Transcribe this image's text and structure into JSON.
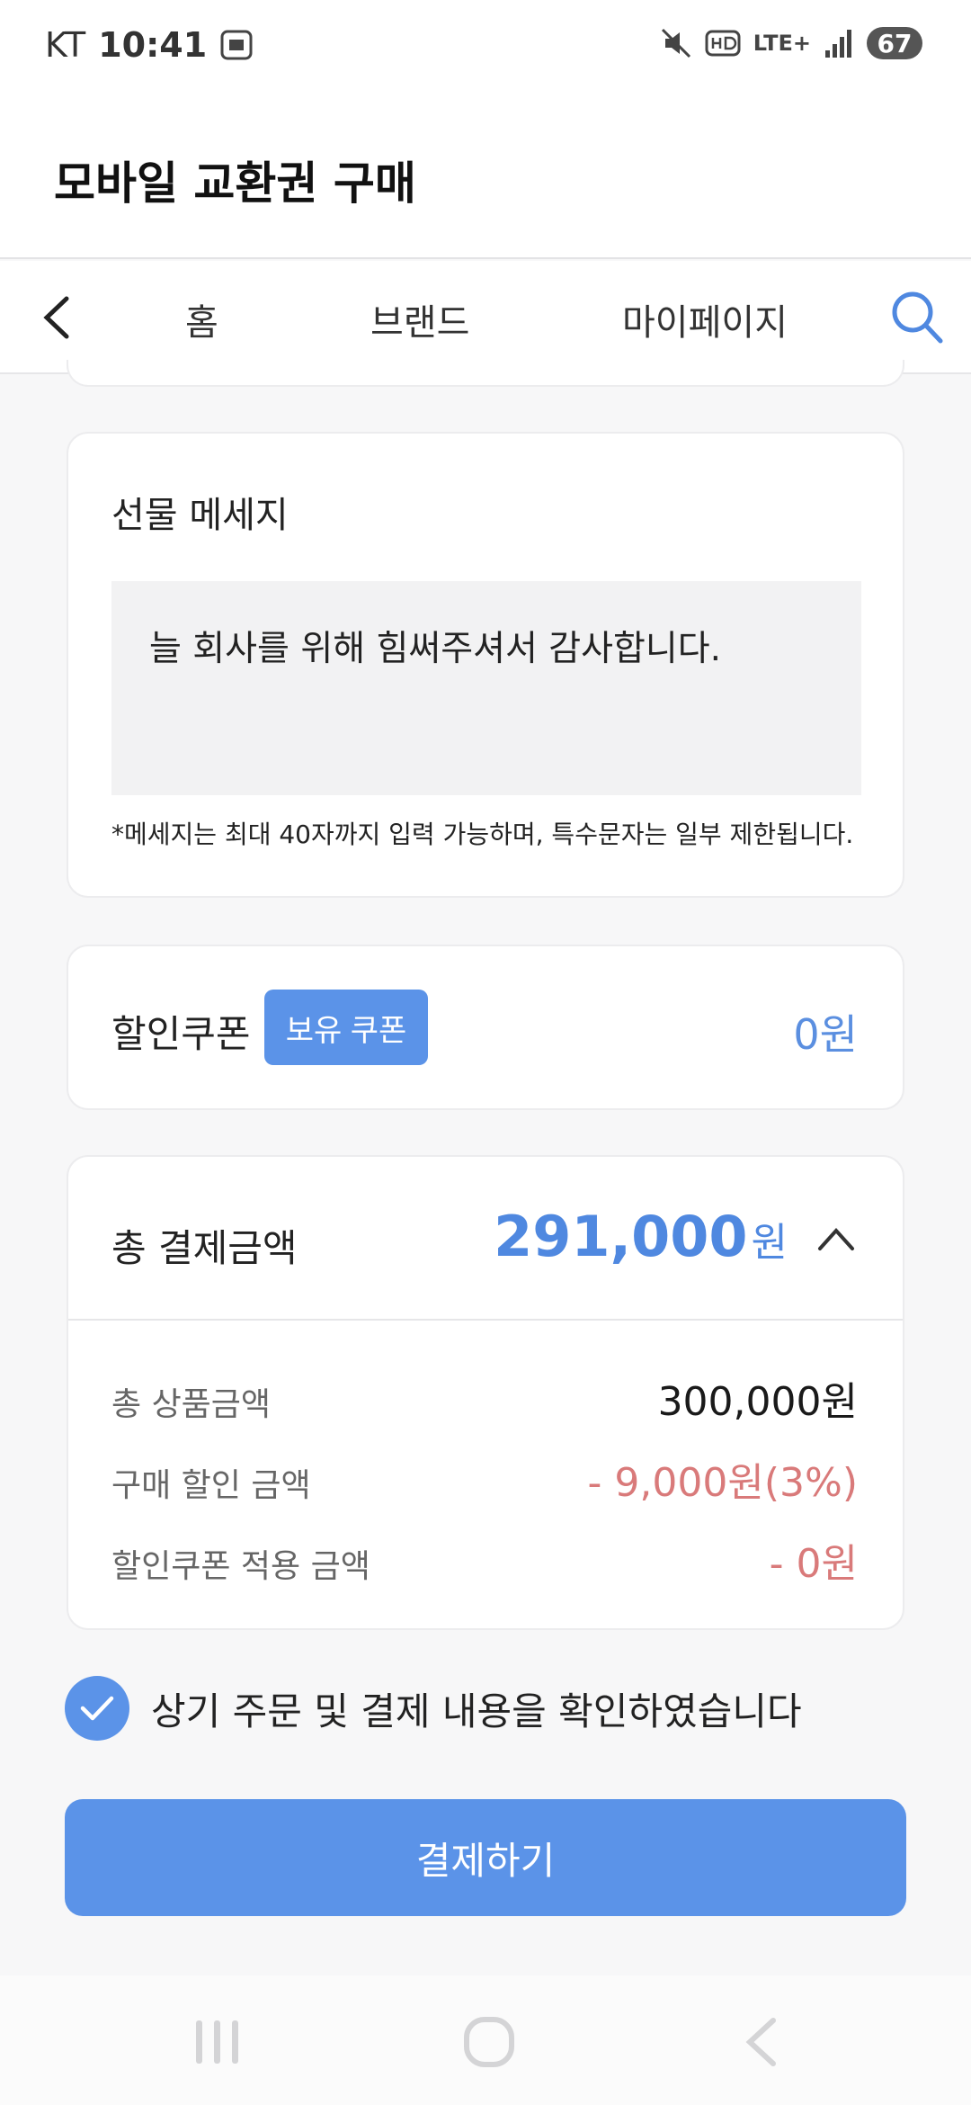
{
  "status_bar": {
    "carrier": "KT",
    "time": "10:41",
    "network": "LTE+",
    "battery": "67"
  },
  "header": {
    "title": "모바일 교환권 구매"
  },
  "nav": {
    "items": [
      "홈",
      "브랜드",
      "마이페이지"
    ]
  },
  "message": {
    "title": "선물 메세지",
    "text": "늘 회사를 위해 힘써주셔서 감사합니다.",
    "note": "*메세지는 최대 40자까지 입력 가능하며, 특수문자는 일부 제한됩니다."
  },
  "coupon": {
    "label": "할인쿠폰",
    "button": "보유 쿠폰",
    "value": "0원"
  },
  "total": {
    "label": "총 결제금액",
    "amount": "291,000",
    "unit": "원",
    "rows": [
      {
        "label": "총 상품금액",
        "value": "300,000원"
      },
      {
        "label": "구매 할인 금액",
        "value": "- 9,000원(3%)"
      },
      {
        "label": "할인쿠폰 적용 금액",
        "value": "- 0원"
      }
    ]
  },
  "confirm": {
    "text": "상기 주문 및 결제 내용을 확인하였습니다",
    "checked": true
  },
  "pay_button": "결제하기",
  "colors": {
    "accent": "#5b93e8",
    "discount": "#d97a7a"
  }
}
